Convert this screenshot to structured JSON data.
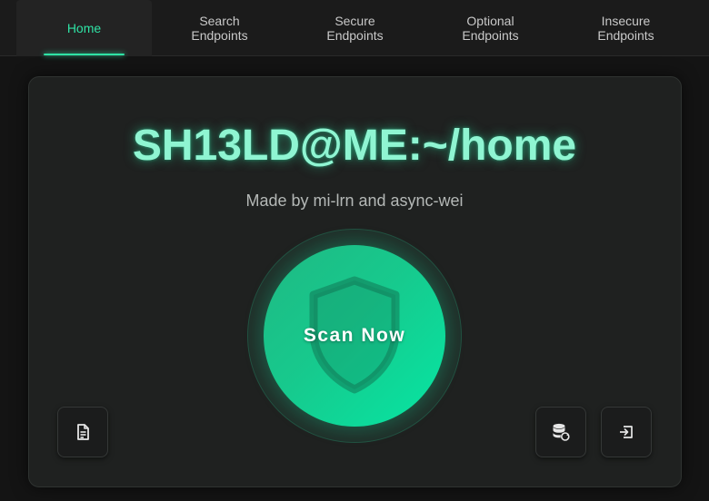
{
  "nav": {
    "tabs": [
      {
        "label": "Home",
        "active": true
      },
      {
        "label": "Search Endpoints",
        "active": false
      },
      {
        "label": "Secure Endpoints",
        "active": false
      },
      {
        "label": "Optional Endpoints",
        "active": false
      },
      {
        "label": "Insecure Endpoints",
        "active": false
      }
    ]
  },
  "hero": {
    "title": "SH13LD@ME:~/home",
    "subtitle": "Made by mi-lrn and async-wei"
  },
  "scan": {
    "label": "Scan Now",
    "icon": "shield-icon"
  },
  "actions": {
    "left": {
      "icon": "document-icon"
    },
    "right": [
      {
        "icon": "database-refresh-icon"
      },
      {
        "icon": "logout-icon"
      }
    ]
  },
  "colors": {
    "accent": "#2fe3a5",
    "title": "#8ff5d2",
    "background": "#141414",
    "card": "#1f2120"
  }
}
